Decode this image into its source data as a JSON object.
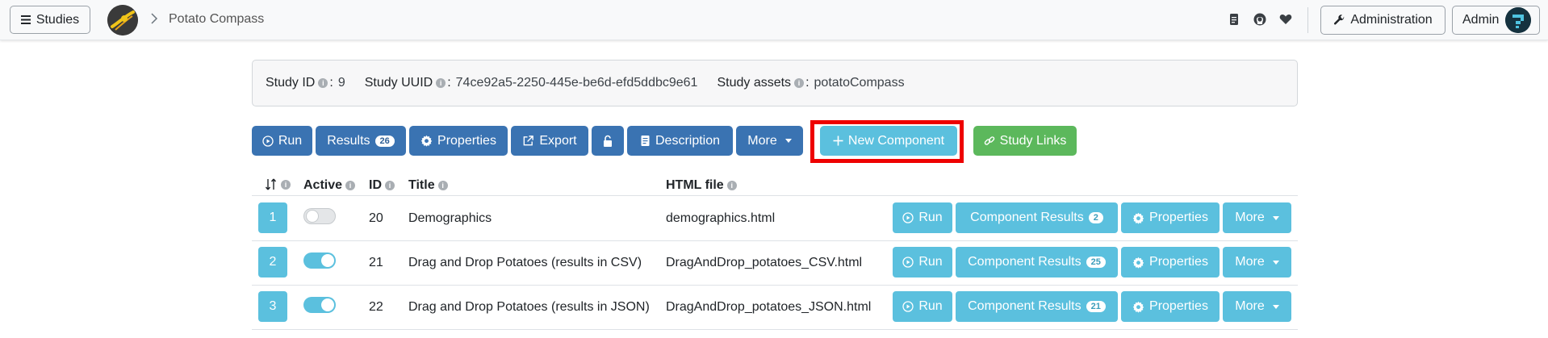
{
  "navbar": {
    "studies_label": "Studies",
    "breadcrumb": "Potato Compass",
    "administration_label": "Administration",
    "user_label": "Admin"
  },
  "study_info": {
    "id_label": "Study ID",
    "id_value": "9",
    "uuid_label": "Study UUID",
    "uuid_value": "74ce92a5-2250-445e-be6d-efd5ddbc9e61",
    "assets_label": "Study assets",
    "assets_value": "potatoCompass"
  },
  "toolbar": {
    "run_label": "Run",
    "results_label": "Results",
    "results_count": "26",
    "properties_label": "Properties",
    "export_label": "Export",
    "description_label": "Description",
    "more_label": "More",
    "new_component_label": "New Component",
    "study_links_label": "Study Links"
  },
  "table": {
    "headers": {
      "active": "Active",
      "id": "ID",
      "title": "Title",
      "html_file": "HTML file"
    },
    "rows": [
      {
        "position": "1",
        "active": false,
        "id": "20",
        "title": "Demographics",
        "html_file": "demographics.html",
        "results_count": "2"
      },
      {
        "position": "2",
        "active": true,
        "id": "21",
        "title": "Drag and Drop Potatoes (results in CSV)",
        "html_file": "DragAndDrop_potatoes_CSV.html",
        "results_count": "25"
      },
      {
        "position": "3",
        "active": true,
        "id": "22",
        "title": "Drag and Drop Potatoes (results in JSON)",
        "html_file": "DragAndDrop_potatoes_JSON.html",
        "results_count": "21"
      }
    ],
    "row_buttons": {
      "run_label": "Run",
      "component_results_label": "Component Results",
      "properties_label": "Properties",
      "more_label": "More"
    }
  },
  "colors": {
    "primary": "#3a73b2",
    "info": "#5bc0de",
    "success": "#5cb85c",
    "highlight": "#ee0000"
  }
}
